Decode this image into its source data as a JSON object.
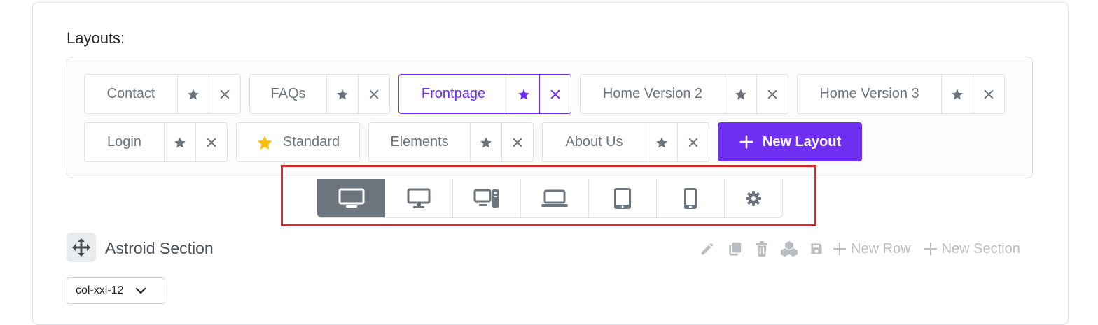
{
  "layouts": {
    "title": "Layouts:",
    "chips": [
      {
        "name": "Contact"
      },
      {
        "name": "FAQs"
      },
      {
        "name": "Frontpage"
      },
      {
        "name": "Home Version 2"
      },
      {
        "name": "Home Version 3"
      },
      {
        "name": "Login"
      },
      {
        "name": "Standard"
      },
      {
        "name": "Elements"
      },
      {
        "name": "About Us"
      }
    ],
    "new_layout_label": "New Layout"
  },
  "colors": {
    "accent": "#6f2ff0",
    "star_default": "#ffc107",
    "device_active_bg": "#6c757d",
    "highlight": "#e0252c"
  },
  "devices": [
    {
      "icon": "desktop-large-icon",
      "active": true
    },
    {
      "icon": "desktop-icon"
    },
    {
      "icon": "desktop-tower-icon"
    },
    {
      "icon": "laptop-icon"
    },
    {
      "icon": "tablet-icon"
    },
    {
      "icon": "mobile-icon"
    },
    {
      "icon": "gear-icon"
    }
  ],
  "section": {
    "title": "Astroid Section",
    "new_row_label": "New Row",
    "new_section_label": "New Section",
    "column_select_value": "col-xxl-12"
  }
}
